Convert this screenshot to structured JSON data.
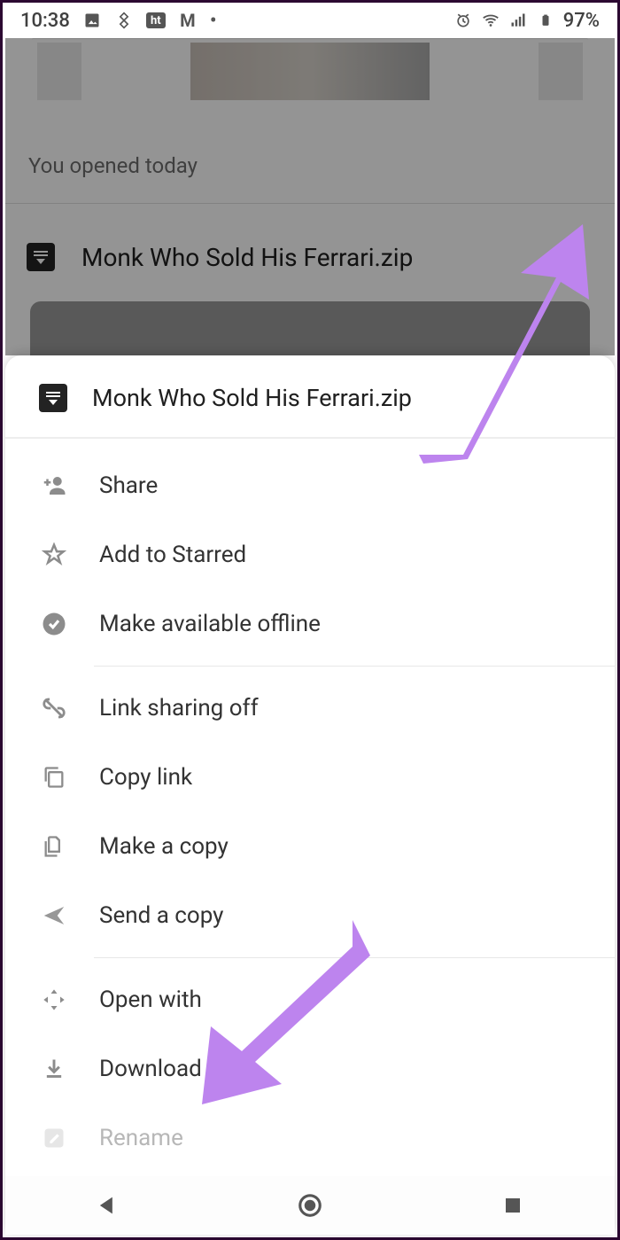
{
  "status": {
    "time": "10:38",
    "battery": "97%"
  },
  "background": {
    "opened_text": "You opened today",
    "file_name": "Monk Who Sold His Ferrari.zip"
  },
  "sheet": {
    "title": "Monk Who Sold His Ferrari.zip",
    "items": {
      "share": "Share",
      "star": "Add to Starred",
      "offline": "Make available offline",
      "link_off": "Link sharing off",
      "copy_link": "Copy link",
      "make_copy": "Make a copy",
      "send_copy": "Send a copy",
      "open_with": "Open with",
      "download": "Download",
      "rename": "Rename"
    }
  }
}
